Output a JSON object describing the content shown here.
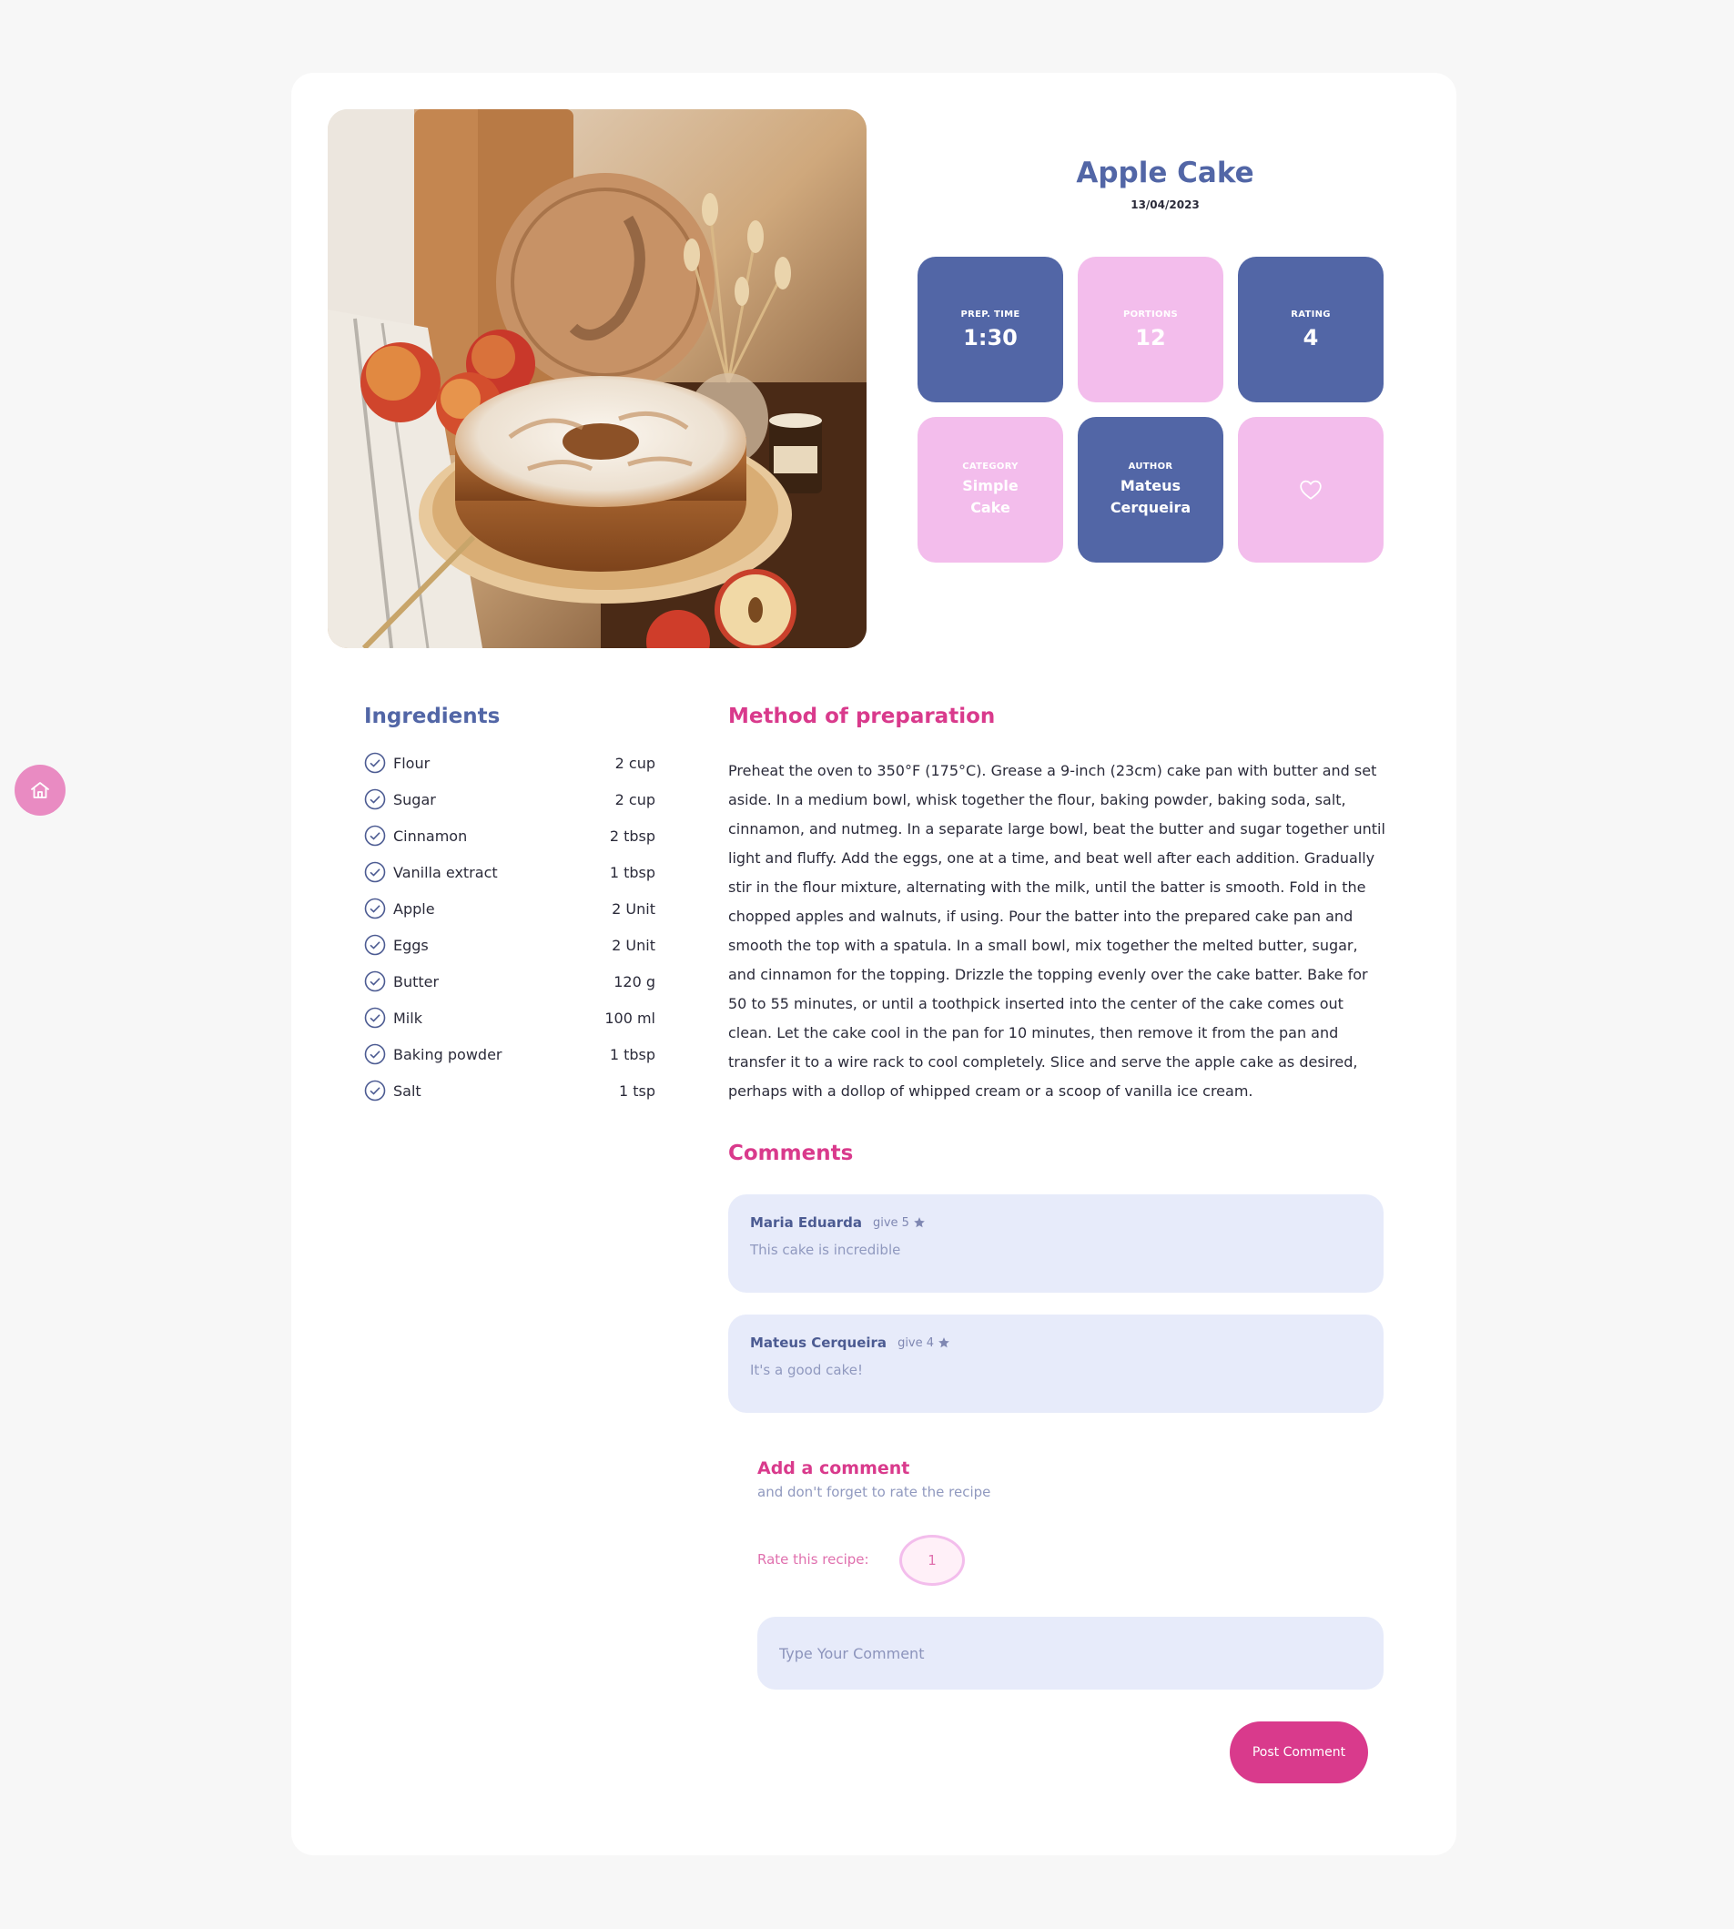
{
  "recipe": {
    "title": "Apple Cake",
    "date": "13/04/2023",
    "photo_icon": "apple-cake-photo"
  },
  "tiles": {
    "prep_label": "PREP. TIME",
    "prep_value": "1:30",
    "portions_label": "PORTIONS",
    "portions_value": "12",
    "rating_label": "RATING",
    "rating_value": "4",
    "category_label": "CATEGORY",
    "category_value": "Simple Cake",
    "author_label": "AUTHOR",
    "author_value": "Mateus Cerqueira",
    "favorite_icon": "heart-icon"
  },
  "ingredients": {
    "title": "Ingredients",
    "items": [
      {
        "name": "Flour",
        "qty": "2 cup"
      },
      {
        "name": "Sugar",
        "qty": "2 cup"
      },
      {
        "name": "Cinnamon",
        "qty": "2 tbsp"
      },
      {
        "name": "Vanilla extract",
        "qty": "1 tbsp"
      },
      {
        "name": "Apple",
        "qty": "2 Unit"
      },
      {
        "name": "Eggs",
        "qty": "2 Unit"
      },
      {
        "name": "Butter",
        "qty": "120 g"
      },
      {
        "name": "Milk",
        "qty": "100 ml"
      },
      {
        "name": "Baking powder",
        "qty": "1 tbsp"
      },
      {
        "name": "Salt",
        "qty": "1 tsp"
      }
    ]
  },
  "method": {
    "title": "Method of preparation",
    "text": "Preheat the oven to 350°F (175°C). Grease a 9-inch (23cm) cake pan with butter and set aside. In a medium bowl, whisk together the flour, baking powder, baking soda, salt, cinnamon, and nutmeg. In a separate large bowl, beat the butter and sugar together until light and fluffy. Add the eggs, one at a time, and beat well after each addition. Gradually stir in the flour mixture, alternating with the milk, until the batter is smooth. Fold in the chopped apples and walnuts, if using. Pour the batter into the prepared cake pan and smooth the top with a spatula. In a small bowl, mix together the melted butter, sugar, and cinnamon for the topping. Drizzle the topping evenly over the cake batter. Bake for 50 to 55 minutes, or until a toothpick inserted into the center of the cake comes out clean. Let the cake cool in the pan for 10 minutes, then remove it from the pan and transfer it to a wire rack to cool completely. Slice and serve the apple cake as desired, perhaps with a dollop of whipped cream or a scoop of vanilla ice cream."
  },
  "comments": {
    "title": "Comments",
    "items": [
      {
        "author": "Maria Eduarda",
        "give": "give 5",
        "text": "This cake is incredible"
      },
      {
        "author": "Mateus Cerqueira",
        "give": "give 4",
        "text": "It's a good cake!"
      }
    ]
  },
  "add_comment": {
    "title": "Add a comment",
    "subtitle": "and don't forget to rate the recipe",
    "rate_label": "Rate this recipe:",
    "rate_value": "1",
    "placeholder": "Type Your Comment",
    "button": "Post Comment"
  },
  "nav": {
    "home_icon": "home-icon"
  },
  "colors": {
    "primary_blue": "#5266a6",
    "accent_pink": "#d93a8c",
    "light_pink": "#f3bdec",
    "comment_bg": "#e7ebfa"
  }
}
